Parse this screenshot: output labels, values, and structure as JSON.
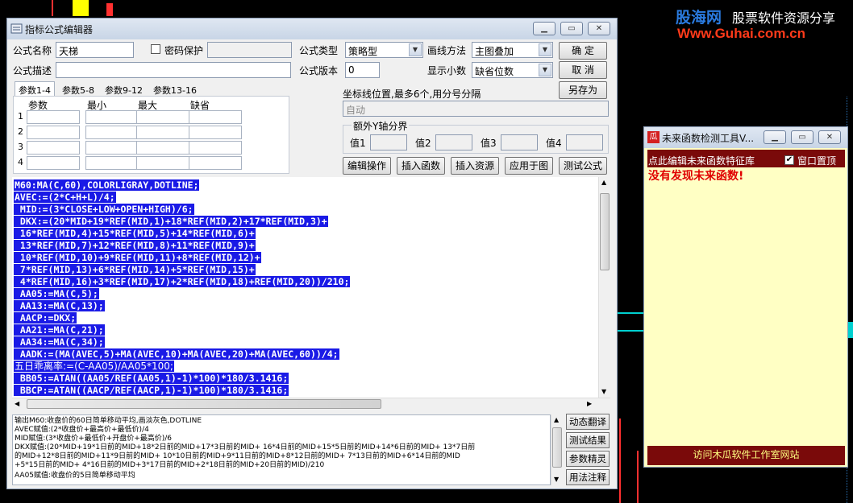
{
  "main_window": {
    "title": "指标公式编辑器",
    "labels": {
      "name": "公式名称",
      "password": "密码保护",
      "type": "公式类型",
      "draw_method": "画线方法",
      "desc": "公式描述",
      "version": "公式版本",
      "decimals": "显示小数",
      "coord": "坐标线位置,最多6个,用分号分隔",
      "extra_y": "额外Y轴分界",
      "v1": "值1",
      "v2": "值2",
      "v3": "值3",
      "v4": "值4"
    },
    "fields": {
      "name_value": "天梯",
      "version_value": "0",
      "coord_value": "自动",
      "type_value": "策略型",
      "draw_value": "主图叠加",
      "decimals_value": "缺省位数"
    },
    "buttons": {
      "ok": "确  定",
      "cancel": "取  消",
      "save_as": "另存为",
      "edit_ops": "编辑操作",
      "insert_func": "插入函数",
      "insert_res": "插入资源",
      "apply": "应用于图",
      "test": "测试公式"
    },
    "tabs": [
      "参数1-4",
      "参数5-8",
      "参数9-12",
      "参数13-16"
    ],
    "param_headers": [
      "参数",
      "最小",
      "最大",
      "缺省"
    ],
    "param_rows": [
      "1",
      "2",
      "3",
      "4"
    ],
    "code_lines": [
      "M60:MA(C,60),COLORLIGRAY,DOTLINE;",
      "AVEC:=(2*C+H+L)/4;",
      " MID:=(3*CLOSE+LOW+OPEN+HIGH)/6;",
      " DKX:=(20*MID+19*REF(MID,1)+18*REF(MID,2)+17*REF(MID,3)+",
      " 16*REF(MID,4)+15*REF(MID,5)+14*REF(MID,6)+",
      " 13*REF(MID,7)+12*REF(MID,8)+11*REF(MID,9)+",
      " 10*REF(MID,10)+9*REF(MID,11)+8*REF(MID,12)+",
      " 7*REF(MID,13)+6*REF(MID,14)+5*REF(MID,15)+",
      " 4*REF(MID,16)+3*REF(MID,17)+2*REF(MID,18)+REF(MID,20))/210;",
      " AA05:=MA(C,5);",
      " AA13:=MA(C,13);",
      " AACP:=DKX;",
      " AA21:=MA(C,21);",
      " AA34:=MA(C,34);",
      " AADK:=(MA(AVEC,5)+MA(AVEC,10)+MA(AVEC,20)+MA(AVEC,60))/4;",
      "五日乖离率:=(C-AA05)/AA05*100;",
      " BB05:=ATAN((AA05/REF(AA05,1)-1)*100)*180/3.1416;",
      " BBCP:=ATAN((AACP/REF(AACP,1)-1)*100)*180/3.1416;"
    ],
    "output_lines": [
      "输出M60:收盘价的60日简单移动平均,画淡灰色,DOTLINE",
      "AVEC赋值:(2*收盘价+最高价+最低价)/4",
      "MID赋值:(3*收盘价+最低价+开盘价+最高价)/6",
      "DKX赋值:(20*MID+19*1日前的MID+18*2日前的MID+17*3日前的MID+ 16*4日前的MID+15*5日前的MID+14*6日前的MID+ 13*7日前",
      "的MID+12*8日前的MID+11*9日前的MID+ 10*10日前的MID+9*11日前的MID+8*12日前的MID+ 7*13日前的MID+6*14日前的MID",
      "+5*15日前的MID+ 4*16日前的MID+3*17日前的MID+2*18日前的MID+20日前的MID)/210",
      "AA05赋值:收盘价的5日简单移动平均"
    ],
    "side_buttons": [
      "动态翻译",
      "测试结果",
      "参数精灵",
      "用法注释"
    ]
  },
  "detector_window": {
    "title": "未来函数检测工具V...",
    "header": "点此编辑未来函数特征库",
    "topmost_label": "窗口置顶",
    "result": "没有发现未来函数!",
    "footer": "访问木瓜软件工作室网站"
  },
  "watermark": {
    "brand": "股海网",
    "slogan": "股票软件资源分享",
    "url": "Www.Guhai.com.cn"
  },
  "colors": {
    "selection": "#1a1ae6",
    "detector_bg": "#ffffc4",
    "detector_bar": "#7a0a0a",
    "result_red": "#e00000"
  }
}
